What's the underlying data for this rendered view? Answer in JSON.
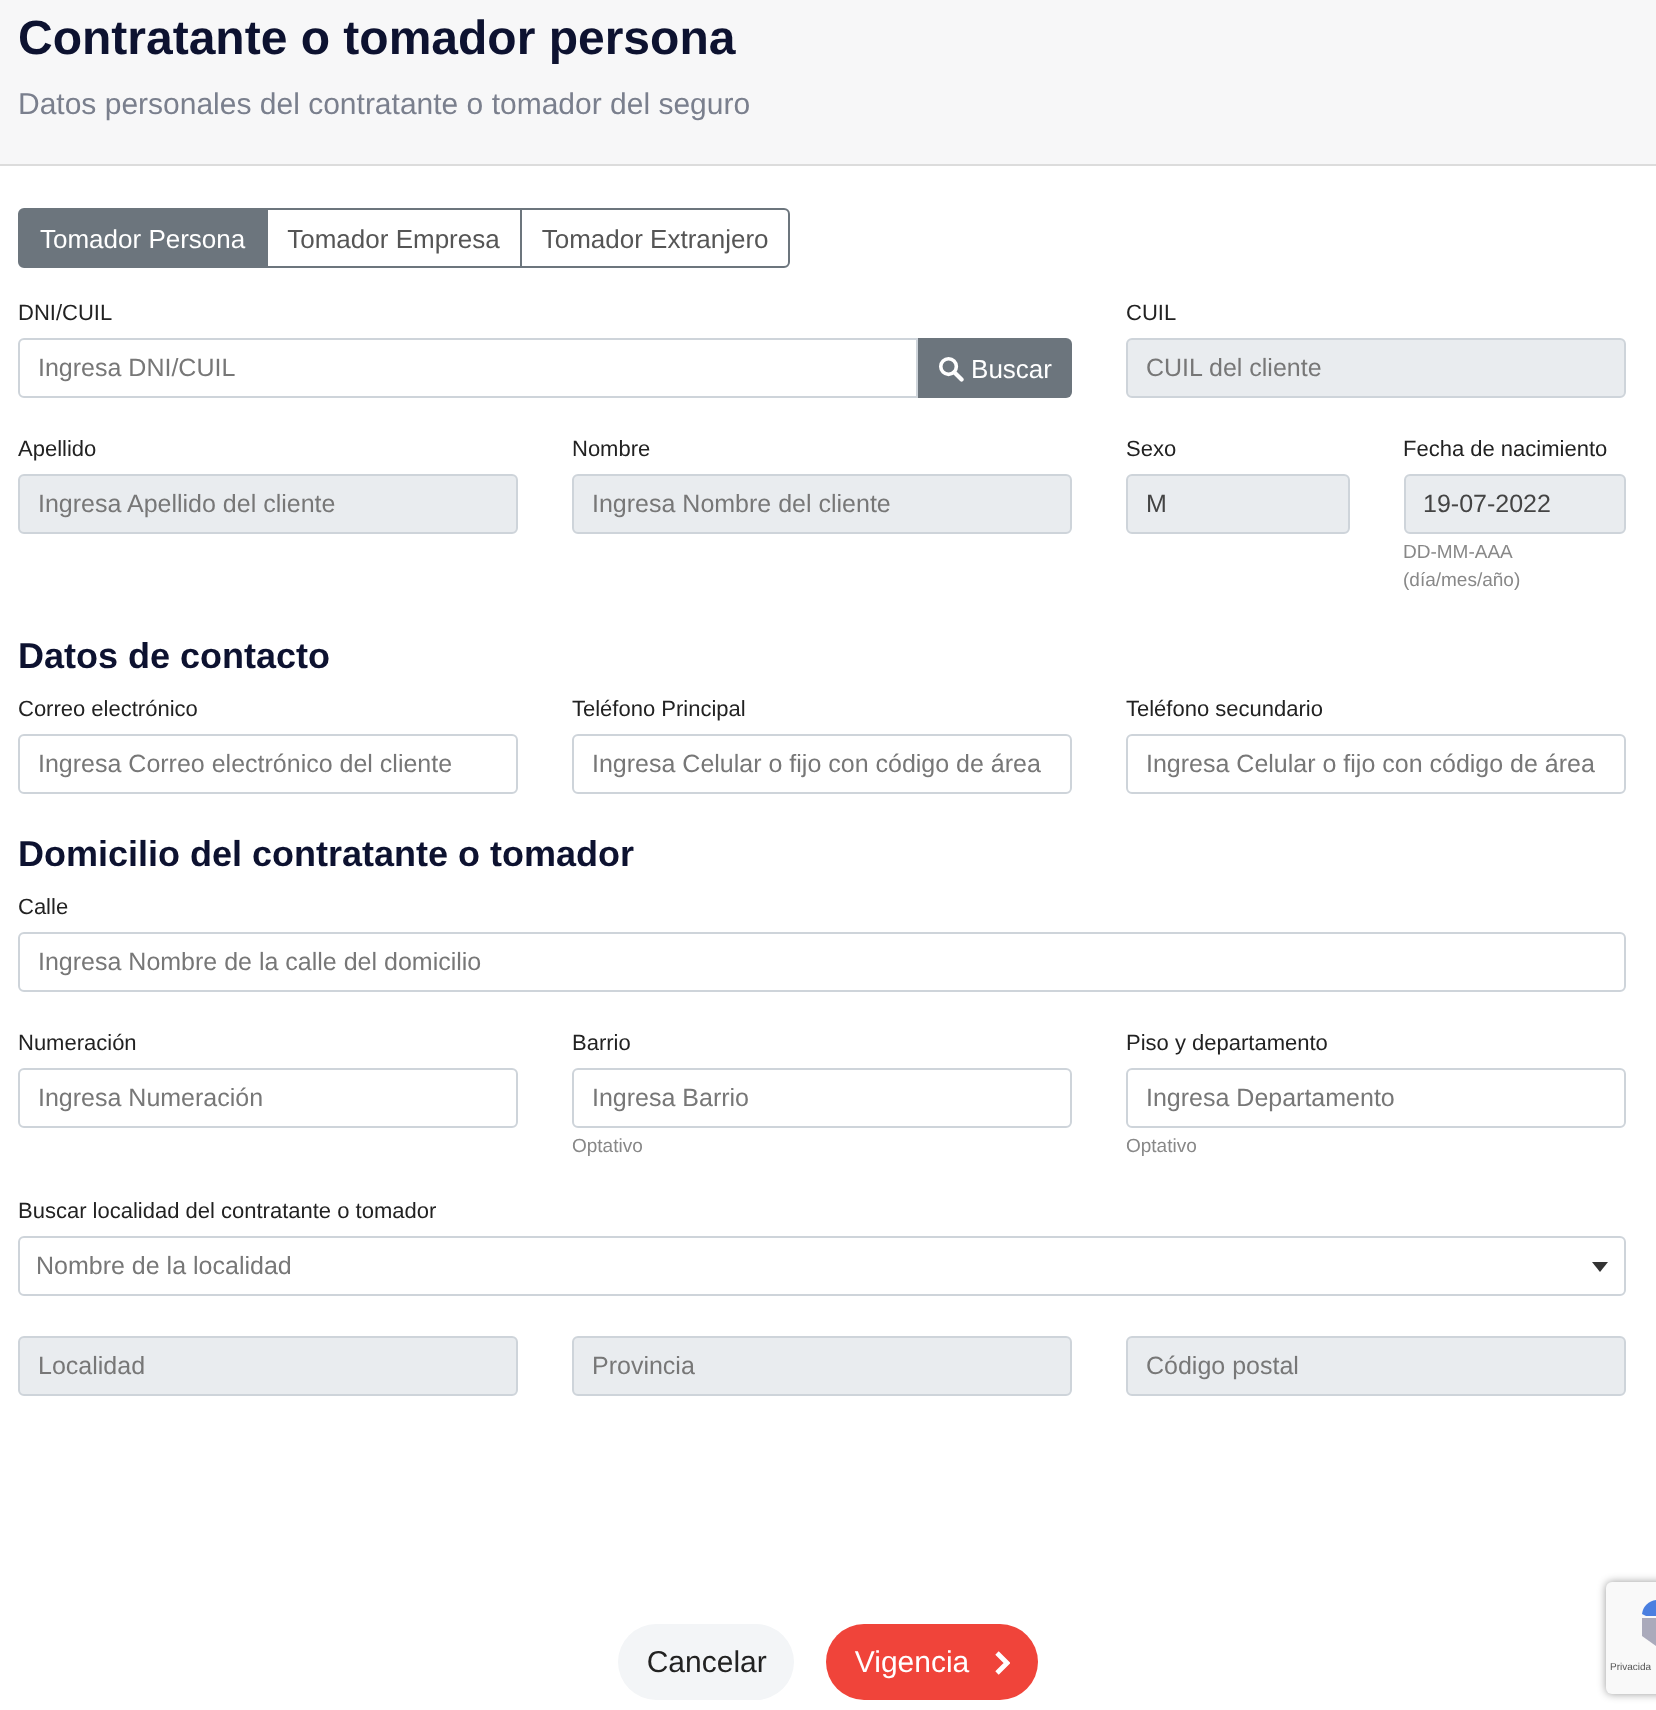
{
  "header": {
    "title": "Contratante o tomador persona",
    "subtitle": "Datos personales del contratante o tomador del seguro"
  },
  "tabs": [
    {
      "label": "Tomador Persona",
      "selected": true
    },
    {
      "label": "Tomador Empresa",
      "selected": false
    },
    {
      "label": "Tomador Extranjero",
      "selected": false
    }
  ],
  "sections": [
    {
      "rows": [
        {
          "fields": [
            {
              "kind": "search",
              "label": "DNI/CUIL",
              "placeholder": "Ingresa DNI/CUIL",
              "disabled": false,
              "button": "Buscar"
            },
            {
              "kind": "input",
              "label": "CUIL",
              "placeholder": "CUIL del cliente",
              "disabled": true
            }
          ]
        },
        {
          "fields": [
            {
              "kind": "input",
              "label": "Apellido",
              "placeholder": "Ingresa Apellido del cliente",
              "disabled": true
            },
            {
              "kind": "input",
              "label": "Nombre",
              "placeholder": "Ingresa Nombre del cliente",
              "disabled": true
            },
            {
              "kind": "input",
              "label": "Sexo",
              "value": "M",
              "disabled": true
            },
            {
              "kind": "input",
              "label": "Fecha de nacimiento",
              "value": "19-07-2022",
              "disabled": true,
              "hint": "DD-MM-AAA (día/mes/año)"
            }
          ]
        }
      ]
    },
    {
      "heading": "Datos de contacto",
      "rows": [
        {
          "fields": [
            {
              "kind": "input",
              "label": "Correo electrónico",
              "placeholder": "Ingresa Correo electrónico del cliente",
              "disabled": false
            },
            {
              "kind": "input",
              "label": "Teléfono Principal",
              "placeholder": "Ingresa Celular o fijo con código de área",
              "disabled": false
            },
            {
              "kind": "input",
              "label": "Teléfono secundario",
              "placeholder": "Ingresa Celular o fijo con código de área",
              "disabled": false
            }
          ]
        }
      ]
    },
    {
      "heading": "Domicilio del contratante o tomador",
      "rows": [
        {
          "fields": [
            {
              "kind": "input",
              "label": "Calle",
              "placeholder": "Ingresa Nombre de la calle del domicilio",
              "disabled": false
            }
          ]
        },
        {
          "fields": [
            {
              "kind": "input",
              "label": "Numeración",
              "placeholder": "Ingresa Numeración",
              "disabled": false
            },
            {
              "kind": "input",
              "label": "Barrio",
              "placeholder": "Ingresa Barrio",
              "disabled": false,
              "hint": "Optativo"
            },
            {
              "kind": "input",
              "label": "Piso y departamento",
              "placeholder": "Ingresa Departamento",
              "disabled": false,
              "hint": "Optativo"
            }
          ]
        },
        {
          "fields": [
            {
              "kind": "select",
              "label": "Buscar localidad del contratante o tomador",
              "placeholder": "Nombre de la localidad",
              "disabled": false
            }
          ]
        },
        {
          "fields": [
            {
              "kind": "input",
              "placeholder": "Localidad",
              "disabled": true
            },
            {
              "kind": "input",
              "placeholder": "Provincia",
              "disabled": true
            },
            {
              "kind": "input",
              "placeholder": "Código postal",
              "disabled": true
            }
          ]
        }
      ]
    }
  ],
  "actions": [
    {
      "kind": "secondary",
      "label": "Cancelar"
    },
    {
      "kind": "primary",
      "label": "Vigencia"
    }
  ],
  "recaptcha": {
    "text": "Privacida"
  }
}
